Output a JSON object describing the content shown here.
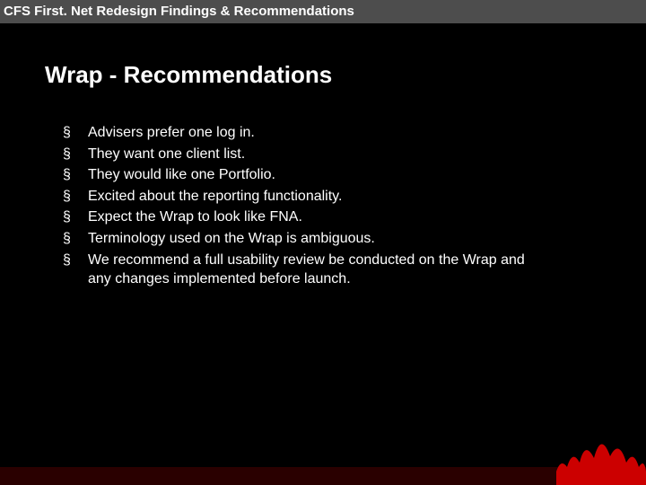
{
  "header": {
    "title": "CFS First. Net Redesign Findings & Recommendations"
  },
  "slide": {
    "title": "Wrap - Recommendations"
  },
  "bullets": {
    "items": [
      "Advisers prefer one log in.",
      "They want one client list.",
      "They would like one Portfolio.",
      "Excited about the reporting functionality.",
      "Expect the Wrap to look like FNA.",
      "Terminology used on the Wrap is ambiguous.",
      "We recommend a full usability review be conducted on the Wrap and any changes implemented before launch."
    ]
  },
  "colors": {
    "accent": "#cc0000",
    "headerBg": "#4d4d4d",
    "footerBg": "#2a0000"
  }
}
